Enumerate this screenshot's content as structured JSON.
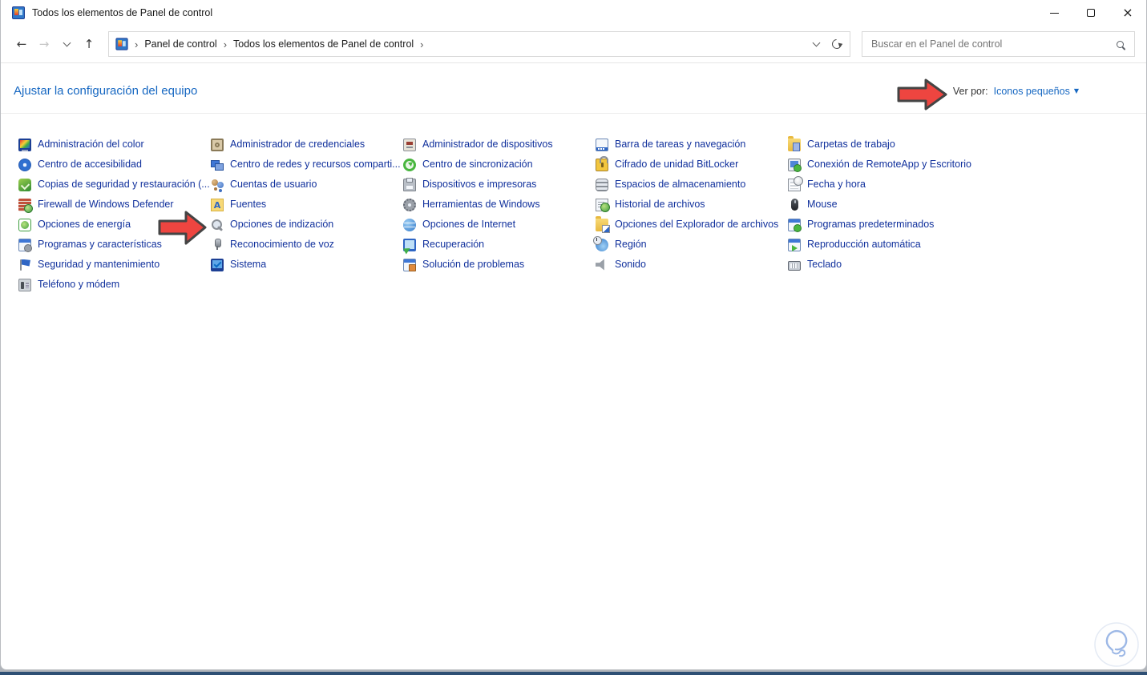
{
  "window": {
    "title": "Todos los elementos de Panel de control"
  },
  "icons": {
    "back": "←",
    "forward": "→",
    "up": "↑",
    "close": "×",
    "caret_down": "▼",
    "breadcrumb_sep": "›"
  },
  "toolbar": {
    "breadcrumb": {
      "items": [
        "Panel de control",
        "Todos los elementos de Panel de control"
      ]
    },
    "search_placeholder": "Buscar en el Panel de control"
  },
  "header": {
    "title": "Ajustar la configuración del equipo",
    "view_by_label": "Ver por:",
    "view_by_value": "Iconos pequeños"
  },
  "colors": {
    "accent_blue": "#1768c2",
    "item_link_navy": "#10309c",
    "arrow_red": "#ee4540",
    "arrow_outline": "#444444"
  },
  "columns": [
    {
      "items": [
        {
          "label": "Administración del color",
          "icon": "color-management"
        },
        {
          "label": "Centro de accesibilidad",
          "icon": "ease-of-access"
        },
        {
          "label": "Copias de seguridad y restauración (...",
          "icon": "backup-restore"
        },
        {
          "label": "Firewall de Windows Defender",
          "icon": "firewall"
        },
        {
          "label": "Opciones de energía",
          "icon": "power-options"
        },
        {
          "label": "Programas y características",
          "icon": "programs-features"
        },
        {
          "label": "Seguridad y mantenimiento",
          "icon": "security-maintenance"
        },
        {
          "label": "Teléfono y módem",
          "icon": "phone-modem"
        }
      ]
    },
    {
      "items": [
        {
          "label": "Administrador de credenciales",
          "icon": "credential-manager"
        },
        {
          "label": "Centro de redes y recursos comparti...",
          "icon": "network-center"
        },
        {
          "label": "Cuentas de usuario",
          "icon": "user-accounts"
        },
        {
          "label": "Fuentes",
          "icon": "fonts"
        },
        {
          "label": "Opciones de indización",
          "icon": "indexing-options"
        },
        {
          "label": "Reconocimiento de voz",
          "icon": "speech-recognition"
        },
        {
          "label": "Sistema",
          "icon": "system"
        }
      ]
    },
    {
      "items": [
        {
          "label": "Administrador de dispositivos",
          "icon": "device-manager"
        },
        {
          "label": "Centro de sincronización",
          "icon": "sync-center"
        },
        {
          "label": "Dispositivos e impresoras",
          "icon": "devices-printers"
        },
        {
          "label": "Herramientas de Windows",
          "icon": "windows-tools"
        },
        {
          "label": "Opciones de Internet",
          "icon": "internet-options"
        },
        {
          "label": "Recuperación",
          "icon": "recovery"
        },
        {
          "label": "Solución de problemas",
          "icon": "troubleshooting"
        }
      ]
    },
    {
      "items": [
        {
          "label": "Barra de tareas y navegación",
          "icon": "taskbar-navigation"
        },
        {
          "label": "Cifrado de unidad BitLocker",
          "icon": "bitlocker"
        },
        {
          "label": "Espacios de almacenamiento",
          "icon": "storage-spaces"
        },
        {
          "label": "Historial de archivos",
          "icon": "file-history"
        },
        {
          "label": "Opciones del Explorador de archivos",
          "icon": "file-explorer-options"
        },
        {
          "label": "Región",
          "icon": "region"
        },
        {
          "label": "Sonido",
          "icon": "sound"
        }
      ]
    },
    {
      "items": [
        {
          "label": "Carpetas de trabajo",
          "icon": "work-folders"
        },
        {
          "label": "Conexión de RemoteApp y Escritorio",
          "icon": "remoteapp-desktop"
        },
        {
          "label": "Fecha y hora",
          "icon": "date-time"
        },
        {
          "label": "Mouse",
          "icon": "mouse"
        },
        {
          "label": "Programas predeterminados",
          "icon": "default-programs"
        },
        {
          "label": "Reproducción automática",
          "icon": "autoplay"
        },
        {
          "label": "Teclado",
          "icon": "keyboard"
        }
      ]
    }
  ]
}
